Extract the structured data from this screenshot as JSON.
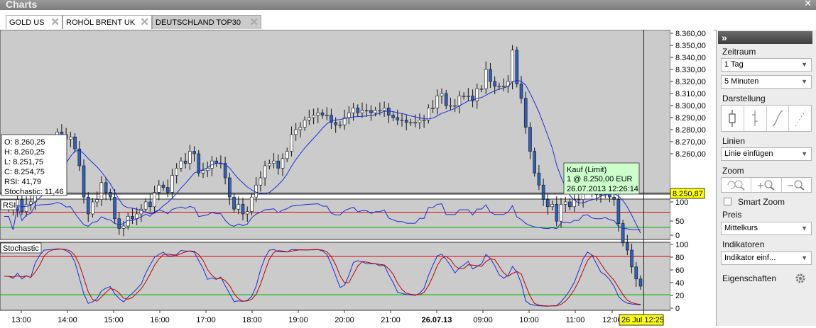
{
  "window": {
    "title": "Charts"
  },
  "tabs": [
    {
      "label": "GOLD US"
    },
    {
      "label": "ROHÖL BRENT UK"
    },
    {
      "label": "DEUTSCHLAND TOP30"
    }
  ],
  "ohlc_box": {
    "o": "O: 8.260,25",
    "h": "H: 8.260,25",
    "l": "L: 8.251,75",
    "c": "C: 8.254,75",
    "rsi": "RSI: 41,79",
    "stoch": "Stochastic: 11,46"
  },
  "order_box": {
    "line1": "Kauf (Limit)",
    "line2": "1 @ 8.250,00 EUR",
    "line3": "26.07.2013 12:26:14"
  },
  "current_price": "8.250,87",
  "current_time": "26 Jul 12:25",
  "indicator_labels": {
    "rsi": "RSI",
    "stoch": "Stochastic"
  },
  "price_axis": [
    "8.360,00",
    "8.350,00",
    "8.340,00",
    "8.330,00",
    "8.320,00",
    "8.310,00",
    "8.300,00",
    "8.290,00",
    "8.280,00",
    "8.270,00",
    "8.260,00"
  ],
  "rsi_axis": [
    "100",
    "50",
    "0"
  ],
  "stoch_axis": [
    "100",
    "80",
    "60",
    "40",
    "20",
    "0"
  ],
  "time_axis": [
    "13:00",
    "14:00",
    "15:00",
    "16:00",
    "17:00",
    "18:00",
    "19:00",
    "20:00",
    "21:00",
    "26.07.13",
    "09:00",
    "10:00",
    "11:00",
    "12:00"
  ],
  "panel": {
    "zeitraum_label": "Zeitraum",
    "zeitraum_value": "1 Tag",
    "interval_value": "5 Minuten",
    "darstellung_label": "Darstellung",
    "linien_label": "Linien",
    "linien_value": "Linie einfügen",
    "zoom_label": "Zoom",
    "smart_zoom_label": "Smart Zoom",
    "preis_label": "Preis",
    "preis_value": "Mittelkurs",
    "indikatoren_label": "Indikatoren",
    "indikatoren_value": "Indikator einf...",
    "eigenschaften_label": "Eigenschaften"
  },
  "colors": {
    "chart_bg": "#cbcbcb",
    "candle_up": "#ffffff",
    "candle_down": "#2f5fbf",
    "ma_line": "#1a2fd6",
    "overbought": "#e00000",
    "oversold": "#00b000",
    "highlight": "#ffff00"
  },
  "chart_data": {
    "type": "candlestick",
    "ylim": [
      8256,
      8361
    ],
    "close": [
      8288,
      8288,
      8287,
      8291,
      8286,
      8289,
      8290,
      8302,
      8305,
      8306,
      8307,
      8309,
      8319,
      8318,
      8316,
      8317,
      8312,
      8305,
      8292,
      8285,
      8290,
      8291,
      8298,
      8294,
      8292,
      8283,
      8279,
      8280,
      8284,
      8283,
      8285,
      8287,
      8290,
      8288,
      8294,
      8297,
      8296,
      8294,
      8301,
      8304,
      8307,
      8306,
      8311,
      8310,
      8302,
      8303,
      8304,
      8307,
      8306,
      8306,
      8300,
      8292,
      8287,
      8289,
      8285,
      8286,
      8292,
      8297,
      8300,
      8305,
      8306,
      8307,
      8304,
      8308,
      8311,
      8318,
      8320,
      8321,
      8324,
      8325,
      8326,
      8327,
      8326,
      8326,
      8323,
      8322,
      8322,
      8325,
      8327,
      8329,
      8327,
      8328,
      8328,
      8327,
      8328,
      8328,
      8329,
      8326,
      8325,
      8324,
      8324,
      8323,
      8323,
      8323,
      8324,
      8324,
      8329,
      8329,
      8334,
      8335,
      8330,
      8330,
      8330,
      8334,
      8334,
      8334,
      8332,
      8337,
      8337,
      8345,
      8340,
      8338,
      8338,
      8338,
      8340,
      8353,
      8339,
      8333,
      8321,
      8311,
      8302,
      8297,
      8291,
      8288,
      8289,
      8282,
      8289,
      8290,
      8288,
      8291,
      8291,
      8297,
      8298,
      8294,
      8293,
      8293,
      8294,
      8292,
      8291,
      8281,
      8273,
      8270,
      8263,
      8258,
      8255
    ]
  }
}
